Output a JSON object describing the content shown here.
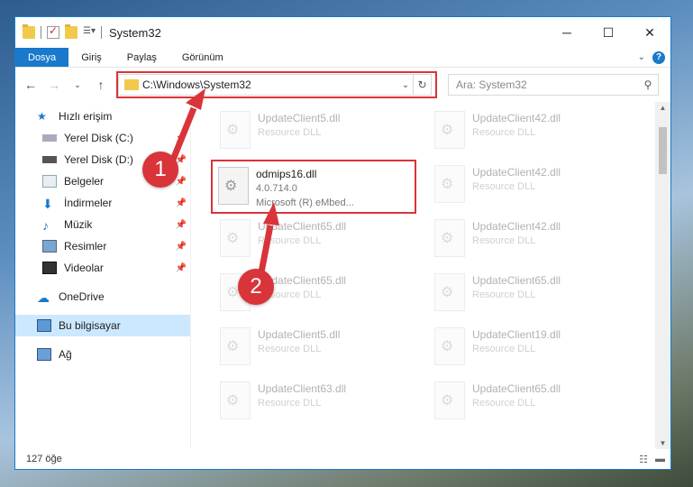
{
  "window": {
    "title": "System32",
    "controls": {
      "minimize": "─",
      "maximize": "☐",
      "close": "✕"
    }
  },
  "ribbon": {
    "tabs": [
      {
        "label": "Dosya",
        "active": true
      },
      {
        "label": "Giriş"
      },
      {
        "label": "Paylaş"
      },
      {
        "label": "Görünüm"
      }
    ]
  },
  "address": {
    "path": "C:\\Windows\\System32",
    "search_placeholder": "Ara: System32"
  },
  "sidebar": {
    "quick_access": "Hızlı erişim",
    "items": [
      {
        "label": "Yerel Disk (C:)",
        "icon": "drive-icon"
      },
      {
        "label": "Yerel Disk (D:)",
        "icon": "drive-icon"
      },
      {
        "label": "Belgeler",
        "icon": "documents-icon"
      },
      {
        "label": "İndirmeler",
        "icon": "downloads-icon"
      },
      {
        "label": "Müzik",
        "icon": "music-icon"
      },
      {
        "label": "Resimler",
        "icon": "pictures-icon"
      },
      {
        "label": "Videolar",
        "icon": "videos-icon"
      }
    ],
    "onedrive": "OneDrive",
    "this_pc": "Bu bilgisayar",
    "network": "Ağ"
  },
  "files": {
    "col1": [
      {
        "name": "UpdateClient5.dll",
        "sub": "Resource DLL"
      },
      {
        "name": "odmips16.dll",
        "sub": "4.0.714.0",
        "sub2": "Microsoft (R) eMbed..."
      },
      {
        "name": "UpdateClient65.dll",
        "sub": "Resource DLL"
      },
      {
        "name": "UpdateClient65.dll",
        "sub": "Resource DLL"
      },
      {
        "name": "UpdateClient5.dll",
        "sub": "Resource DLL"
      },
      {
        "name": "UpdateClient63.dll",
        "sub": "Resource DLL"
      }
    ],
    "col2": [
      {
        "name": "UpdateClient42.dll",
        "sub": "Resource DLL"
      },
      {
        "name": "UpdateClient42.dll",
        "sub": "Resource DLL"
      },
      {
        "name": "UpdateClient42.dll",
        "sub": "Resource DLL"
      },
      {
        "name": "UpdateClient65.dll",
        "sub": "Resource DLL"
      },
      {
        "name": "UpdateClient19.dll",
        "sub": "Resource DLL"
      },
      {
        "name": "UpdateClient65.dll",
        "sub": "Resource DLL"
      }
    ]
  },
  "status": {
    "count": "127 öğe"
  },
  "annotations": {
    "badge1": "1",
    "badge2": "2"
  },
  "colors": {
    "accent": "#1979ca",
    "highlight": "#d9343a"
  }
}
